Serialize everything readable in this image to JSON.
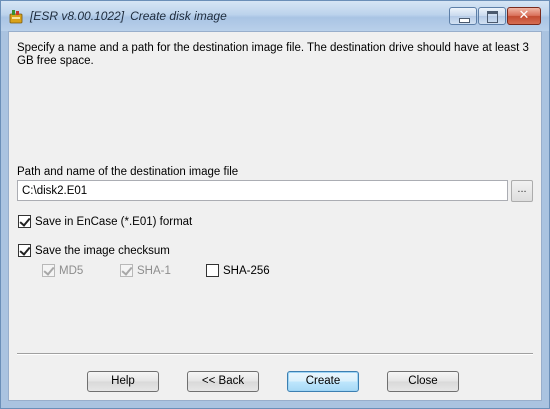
{
  "window": {
    "title_app": "[ESR v8.00.1022]",
    "title_dialog": "Create disk image",
    "icon": "esr-app-icon",
    "controls": {
      "minimize_icon": "minimize-icon",
      "maximize_icon": "maximize-icon",
      "close_icon": "close-icon",
      "close_glyph": "✕"
    }
  },
  "description": "Specify a name and a path for the destination image file. The destination drive should have at least 3 GB free space.",
  "path": {
    "label": "Path and name of the destination image file",
    "value": "C:\\disk2.E01",
    "browse_label": "..."
  },
  "options": {
    "encase": {
      "label": "Save in EnCase (*.E01) format",
      "checked": true,
      "enabled": true
    },
    "checksum": {
      "label": "Save the image checksum",
      "checked": true,
      "enabled": true
    },
    "md5": {
      "label": "MD5",
      "checked": true,
      "enabled": false
    },
    "sha1": {
      "label": "SHA-1",
      "checked": true,
      "enabled": false
    },
    "sha256": {
      "label": "SHA-256",
      "checked": false,
      "enabled": true
    }
  },
  "buttons": {
    "help": "Help",
    "back": "<< Back",
    "create": "Create",
    "close": "Close"
  },
  "colors": {
    "titlebar": "#bcd3ec",
    "client_bg": "#f0f0f0",
    "close_button": "#c24a31",
    "default_button_border": "#3c7fb1"
  }
}
